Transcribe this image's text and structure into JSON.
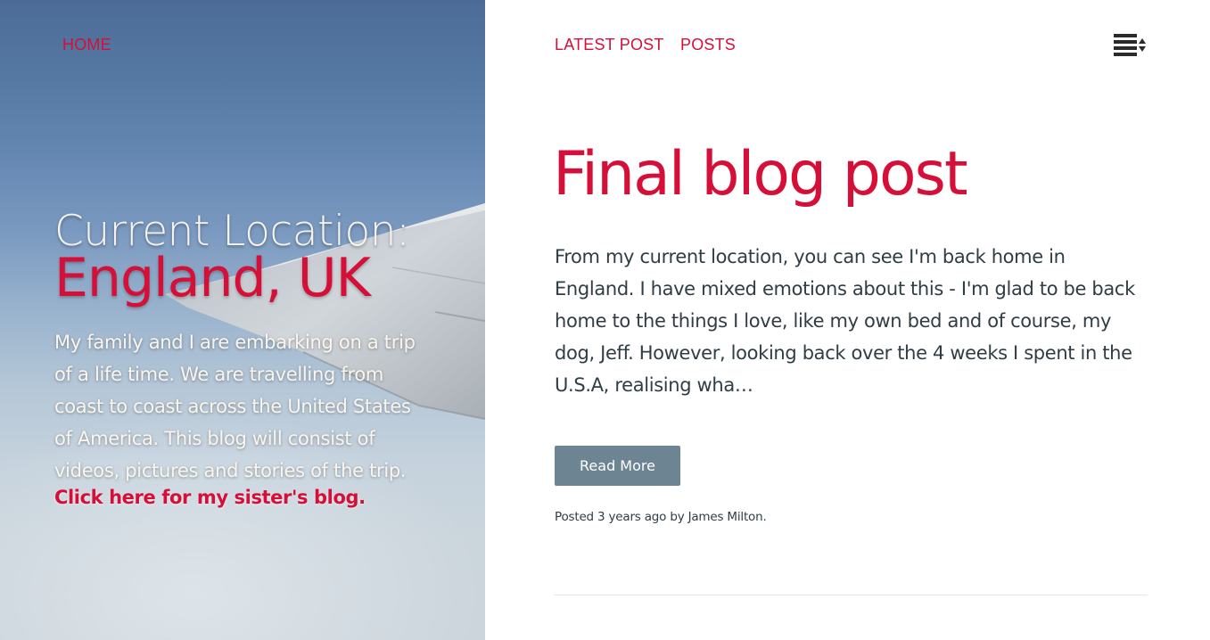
{
  "hero": {
    "home_label": "HOME",
    "location_label": "Current Location:",
    "location_value": "England, UK",
    "intro_lines": [
      "My family and I are embarking on a trip",
      "of a life time. We are travelling from",
      "coast to coast across the United States",
      "of America. This blog will consist of",
      "videos, pictures and stories of the trip."
    ],
    "sister_link": "Click here for my sister's blog."
  },
  "nav": {
    "latest_post": "LATEST POST",
    "posts": "POSTS",
    "menu_icon": "list-sort-icon"
  },
  "post": {
    "title": "Final blog post",
    "excerpt_lines": [
      "From my current location, you can see I'm back home in",
      "England. I have mixed emotions about this - I'm glad to be back",
      "home to the things I love, like my own bed and of course, my",
      "dog, Jeff. However, looking back over the 4 weeks I spent in the",
      "U.S.A, realising wha…"
    ],
    "read_more": "Read More",
    "meta": "Posted 3 years ago by James Milton."
  },
  "colors": {
    "accent": "#d50f37",
    "button": "#6d8592",
    "body_text": "#2f3d44"
  }
}
